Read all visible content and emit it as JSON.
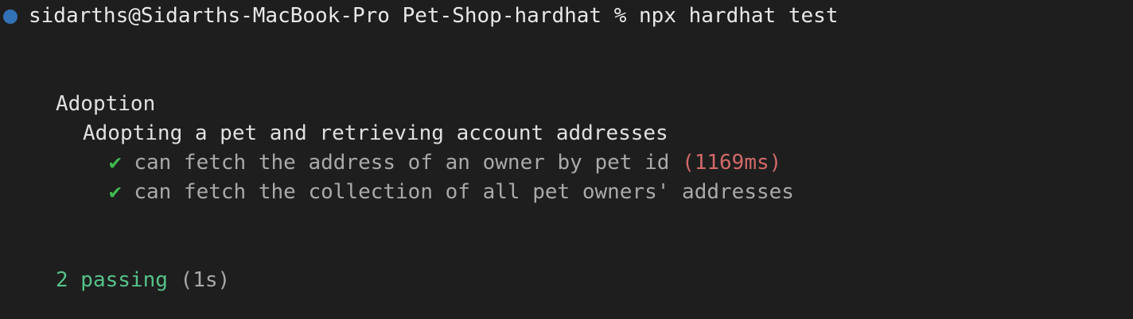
{
  "prompt": {
    "text": "sidarths@Sidarths-MacBook-Pro Pet-Shop-hardhat % npx hardhat test",
    "indicator_color": "#3b8eea"
  },
  "suite": {
    "name": "Adoption",
    "sub_suite": "Adopting a pet and retrieving account addresses",
    "tests": [
      {
        "check": "✔",
        "title": "can fetch the address of an owner by pet id",
        "duration": "(1169ms)"
      },
      {
        "check": "✔",
        "title": "can fetch the collection of all pet owners' addresses",
        "duration": ""
      }
    ]
  },
  "summary": {
    "passing": "2 passing",
    "duration": "(1s)"
  },
  "colors": {
    "background": "#1e1e1e",
    "pass": "#55c28a",
    "slow": "#d16969",
    "dim": "#a9a9a9"
  }
}
